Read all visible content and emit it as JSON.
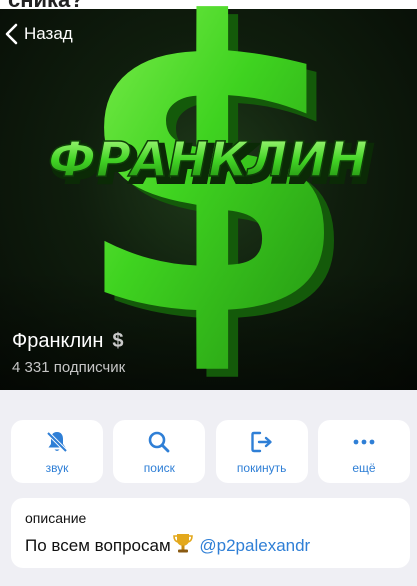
{
  "nav": {
    "back_label": "Назад"
  },
  "top_partial_text": "сника?",
  "artwork": {
    "word": "ФРАНКЛИН",
    "symbol": "$"
  },
  "channel": {
    "name": "Франклин",
    "name_emoji": "$",
    "subscribers": "4 331 подписчик"
  },
  "actions": [
    {
      "label": "звук",
      "icon": "bell-slash-icon"
    },
    {
      "label": "поиск",
      "icon": "search-icon"
    },
    {
      "label": "покинуть",
      "icon": "leave-icon"
    },
    {
      "label": "ещё",
      "icon": "more-icon"
    }
  ],
  "description": {
    "label": "описание",
    "text": "По всем вопросам",
    "emoji": "trophy",
    "link": "@p2palexandr"
  },
  "colors": {
    "accent": "#2f7fd6",
    "neon_green": "#4fe02a",
    "background": "#efeff4"
  }
}
